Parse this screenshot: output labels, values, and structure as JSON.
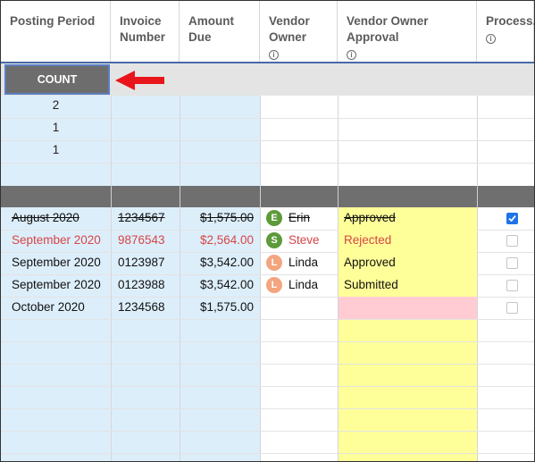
{
  "columns": [
    {
      "label": "Posting Period",
      "info": false
    },
    {
      "label": "Invoice Number",
      "info": false
    },
    {
      "label": "Amount Due",
      "info": false
    },
    {
      "label": "Vendor Owner",
      "info": true
    },
    {
      "label": "Vendor Owner Approval",
      "info": true
    },
    {
      "label": "Process...",
      "info": true
    }
  ],
  "summary": {
    "count_label": "COUNT",
    "counts": [
      "2",
      "1",
      "1"
    ]
  },
  "colors": {
    "approval_yellow": "#ffff99",
    "approval_pink": "#ffccd3",
    "tint_blue": "#ddeefb",
    "rejected_red": "#d64545",
    "arrow_red": "#e8151b",
    "checkbox_blue": "#1e73e8"
  },
  "rows": [
    {
      "period": "August 2020",
      "invoice": "1234567",
      "amount": "$1,575.00",
      "owner": "Erin",
      "owner_initial": "E",
      "avatar_color": "#5c9a3a",
      "approval": "Approved",
      "approval_bg": "yellow",
      "processed": true,
      "style": "strike"
    },
    {
      "period": "September 2020",
      "invoice": "9876543",
      "amount": "$2,564.00",
      "owner": "Steve",
      "owner_initial": "S",
      "avatar_color": "#5c9a3a",
      "approval": "Rejected",
      "approval_bg": "yellow",
      "processed": false,
      "style": "red"
    },
    {
      "period": "September 2020",
      "invoice": "0123987",
      "amount": "$3,542.00",
      "owner": "Linda",
      "owner_initial": "L",
      "avatar_color": "#f3a57f",
      "approval": "Approved",
      "approval_bg": "yellow",
      "processed": false,
      "style": "normal"
    },
    {
      "period": "September 2020",
      "invoice": "0123988",
      "amount": "$3,542.00",
      "owner": "Linda",
      "owner_initial": "L",
      "avatar_color": "#f3a57f",
      "approval": "Submitted",
      "approval_bg": "yellow",
      "processed": false,
      "style": "normal"
    },
    {
      "period": "October 2020",
      "invoice": "1234568",
      "amount": "$1,575.00",
      "owner": "",
      "owner_initial": "",
      "avatar_color": "",
      "approval": "",
      "approval_bg": "pink",
      "processed": false,
      "style": "normal"
    }
  ]
}
